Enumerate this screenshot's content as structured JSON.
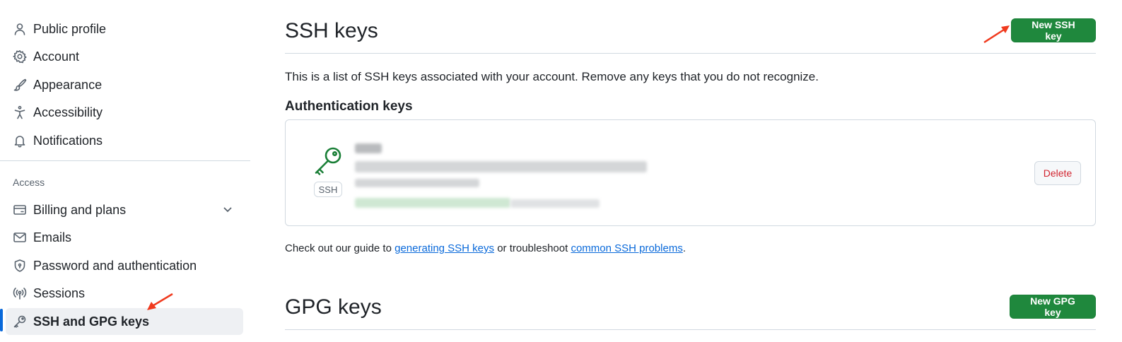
{
  "sidebar": {
    "items": [
      {
        "label": "Public profile",
        "icon": "person-icon"
      },
      {
        "label": "Account",
        "icon": "gear-icon"
      },
      {
        "label": "Appearance",
        "icon": "paintbrush-icon"
      },
      {
        "label": "Accessibility",
        "icon": "accessibility-icon"
      },
      {
        "label": "Notifications",
        "icon": "bell-icon"
      }
    ],
    "access_heading": "Access",
    "access_items": [
      {
        "label": "Billing and plans",
        "icon": "credit-card-icon"
      },
      {
        "label": "Emails",
        "icon": "mail-icon"
      },
      {
        "label": "Password and authentication",
        "icon": "shield-lock-icon"
      },
      {
        "label": "Sessions",
        "icon": "broadcast-icon"
      },
      {
        "label": "SSH and GPG keys",
        "icon": "key-icon"
      }
    ],
    "active_item": "SSH and GPG keys"
  },
  "ssh": {
    "title": "SSH keys",
    "new_button": "New SSH key",
    "description": "This is a list of SSH keys associated with your account. Remove any keys that you do not recognize.",
    "auth_heading": "Authentication keys",
    "key": {
      "type_label": "SSH",
      "delete_button": "Delete"
    }
  },
  "guide": {
    "prefix": "Check out our guide to ",
    "link1": "generating SSH keys",
    "middle": " or troubleshoot ",
    "link2": "common SSH problems",
    "suffix": "."
  },
  "gpg": {
    "title": "GPG keys",
    "new_button": "New GPG key"
  },
  "colors": {
    "primary_green": "#1f883d",
    "danger_red": "#d1242f",
    "link_blue": "#0969da",
    "annotation_red": "#f03a1e"
  }
}
